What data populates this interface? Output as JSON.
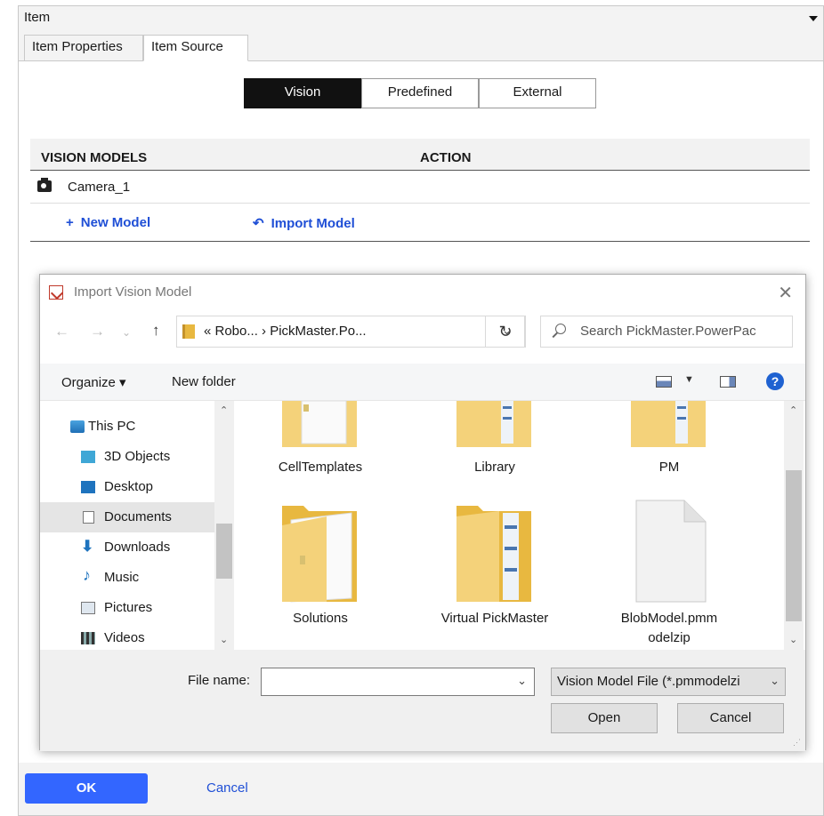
{
  "panel": {
    "title": "Item"
  },
  "tabs": [
    {
      "label": "Item Properties"
    },
    {
      "label": "Item Source"
    }
  ],
  "segments": [
    {
      "label": "Vision"
    },
    {
      "label": "Predefined"
    },
    {
      "label": "External"
    }
  ],
  "vision_models": {
    "headers": {
      "models": "VISION MODELS",
      "action": "ACTION"
    },
    "rows": [
      {
        "name": "Camera_1"
      }
    ],
    "new_model": "New Model",
    "import_model": "Import Model"
  },
  "dialog": {
    "title": "Import Vision Model",
    "address_path": "« Robo... › PickMaster.Po...",
    "search_placeholder": "Search PickMaster.PowerPac",
    "organize": "Organize ▾",
    "new_folder": "New folder",
    "nav": [
      {
        "label": "This PC"
      },
      {
        "label": "3D Objects"
      },
      {
        "label": "Desktop"
      },
      {
        "label": "Documents"
      },
      {
        "label": "Downloads"
      },
      {
        "label": "Music"
      },
      {
        "label": "Pictures"
      },
      {
        "label": "Videos"
      }
    ],
    "files": [
      {
        "name": "CellTemplates"
      },
      {
        "name": "Library"
      },
      {
        "name": "PM"
      },
      {
        "name": "Solutions"
      },
      {
        "name": "Virtual PickMaster"
      },
      {
        "name": "BlobModel.pmm odelzip"
      }
    ],
    "file_name_label": "File name:",
    "file_name_value": "",
    "file_type": "Vision Model File (*.pmmodelzi",
    "open": "Open",
    "cancel": "Cancel"
  },
  "footer": {
    "ok": "OK",
    "cancel": "Cancel"
  },
  "colors": {
    "accent": "#3366ff",
    "link": "#1f4fd6",
    "folder": "#e8b840"
  }
}
